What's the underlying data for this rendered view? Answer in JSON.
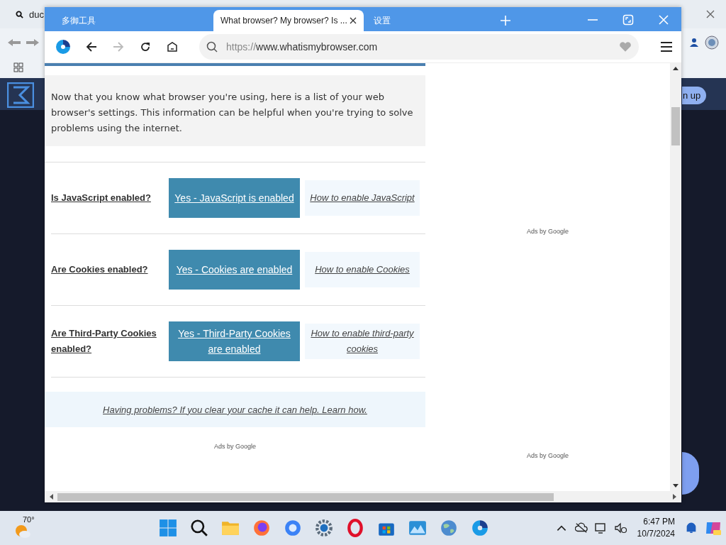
{
  "background_window": {
    "search_tab": "duc",
    "sign_up_button": "n up"
  },
  "browser": {
    "tabs": [
      {
        "label": "多御工具",
        "selected": false
      },
      {
        "label": "What browser? My browser? Is ...",
        "selected": true
      },
      {
        "label": "设置",
        "selected": false
      }
    ],
    "forward_disabled": true,
    "address": {
      "scheme": "https://",
      "host": "www.whatismybrowser.com"
    }
  },
  "page": {
    "intro": "Now that you know what browser you're using, here is a list of your web browser's settings. This information can be helpful when you're trying to solve problems using the internet.",
    "settings": [
      {
        "question": "Is JavaScript enabled?",
        "status": "Yes - JavaScript is enabled",
        "help": "How to enable JavaScript"
      },
      {
        "question": "Are Cookies enabled?",
        "status": "Yes - Cookies are enabled",
        "help": "How to enable Cookies"
      },
      {
        "question": "Are Third-Party Cookies enabled?",
        "status": "Yes - Third-Party Cookies are enabled",
        "help": "How to enable third-party cookies"
      }
    ],
    "help_banner": "Having problems? If you clear your cache it can help. Learn how.",
    "ads_left": "Ads by Google",
    "ads_right": [
      "Ads by Google",
      "Ads by Google"
    ]
  },
  "taskbar": {
    "weather": "70°",
    "time": "6:47 PM",
    "date": "10/7/2024"
  }
}
